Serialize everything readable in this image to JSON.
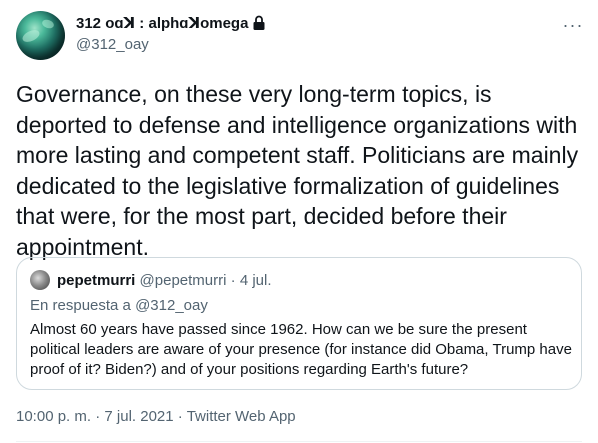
{
  "author": {
    "display_name": "312 oɑꓘ : alphɑꓘomega",
    "handle": "@312_oay",
    "protected_icon": "lock-icon"
  },
  "more_icon": "more-horizontal-icon",
  "more_glyph": "···",
  "tweet": {
    "text": "Governance, on these very long-term topics, is deported to defense and intelligence organizations with more lasting and competent staff. Politicians are mainly dedicated to the legislative formalization of guidelines that were, for the most part, decided before their appointment."
  },
  "quoted": {
    "display_name": "pepetmurri",
    "handle": "@pepetmurri",
    "separator": "·",
    "date": "4 jul.",
    "reply_to": "En respuesta a @312_oay",
    "text": "Almost 60 years have passed since 1962. How can we be sure the present political leaders are aware of your presence (for instance did Obama, Trump have  proof of it? Biden?) and of your positions regarding Earth's future?"
  },
  "meta": {
    "time": "10:00 p. m.",
    "separator": "·",
    "date": "7 jul. 2021",
    "source": "Twitter Web App"
  },
  "colors": {
    "text_primary": "#0f1419",
    "text_secondary": "#536471",
    "border": "#cfd9de"
  }
}
